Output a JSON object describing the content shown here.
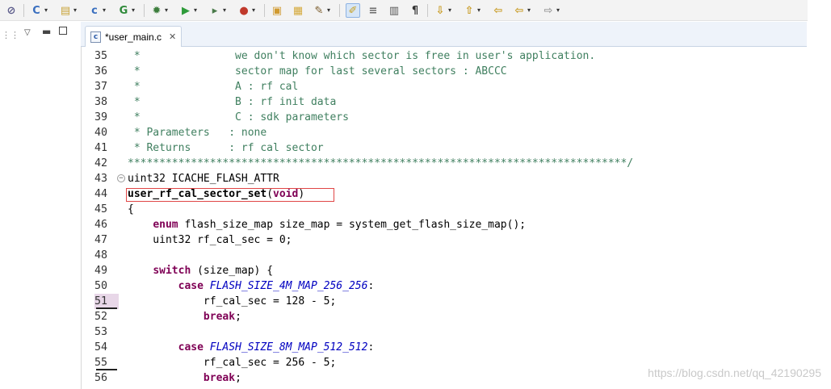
{
  "toolbar": {
    "items": [
      {
        "name": "skip-breakpoints-icon",
        "glyph": "⊘",
        "color": "#5a5a8a",
        "drop": false
      },
      {
        "name": "new-c-project-icon",
        "glyph": "C",
        "color": "#3a6fbf",
        "drop": true
      },
      {
        "name": "new-folder-icon",
        "glyph": "▤",
        "color": "#c8a33a",
        "drop": true
      },
      {
        "name": "new-c-file-icon",
        "glyph": "c",
        "color": "#3a6fbf",
        "drop": true
      },
      {
        "name": "new-class-icon",
        "glyph": "G",
        "color": "#2f8a3a",
        "drop": true
      },
      {
        "name": "debug-icon",
        "glyph": "✹",
        "color": "#3c7d3c",
        "drop": true
      },
      {
        "name": "run-icon",
        "glyph": "▶",
        "color": "#2e9b3a",
        "drop": true
      },
      {
        "name": "run-last-icon",
        "glyph": "▸",
        "color": "#4a7a4a",
        "drop": true
      },
      {
        "name": "external-tools-icon",
        "glyph": "●",
        "color": "#c0392b",
        "drop": true
      },
      {
        "name": "open-type-icon",
        "glyph": "▣",
        "color": "#d09a30",
        "drop": false
      },
      {
        "name": "open-folder-icon",
        "glyph": "▦",
        "color": "#d5a93a",
        "drop": false
      },
      {
        "name": "search-icon",
        "glyph": "✎",
        "color": "#7a5b2a",
        "drop": true
      },
      {
        "name": "mark-occurrences-icon",
        "glyph": "✐",
        "color": "#c7a020",
        "drop": false,
        "active": true
      },
      {
        "name": "toggle-comment-icon",
        "glyph": "≡",
        "color": "#6a6a6a",
        "drop": false
      },
      {
        "name": "show-whitespace-icon",
        "glyph": "▥",
        "color": "#555555",
        "drop": false
      },
      {
        "name": "paragraph-icon",
        "glyph": "¶",
        "color": "#333333",
        "drop": false
      },
      {
        "name": "next-annotation-icon",
        "glyph": "⇩",
        "color": "#c89a20",
        "drop": true
      },
      {
        "name": "previous-annotation-icon",
        "glyph": "⇧",
        "color": "#c89a20",
        "drop": true
      },
      {
        "name": "back-to-edit-icon",
        "glyph": "⇦",
        "color": "#c89a20",
        "drop": false
      },
      {
        "name": "back-icon",
        "glyph": "⇦",
        "color": "#c89a20",
        "drop": true
      },
      {
        "name": "forward-icon",
        "glyph": "⇨",
        "color": "#9a9a9a",
        "drop": true
      }
    ]
  },
  "left_panel": {
    "icons": [
      "view-menu-icon",
      "minimize-icon",
      "maximize-icon"
    ]
  },
  "tab": {
    "title": "*user_main.c",
    "close_glyph": "✕",
    "icon_glyph": "c"
  },
  "code": [
    {
      "n": "35",
      "segs": [
        {
          "t": " *               we don't know which sector is free in user's application.",
          "c": "c"
        }
      ]
    },
    {
      "n": "36",
      "segs": [
        {
          "t": " *               sector map for last several sectors : ABCCC",
          "c": "c"
        }
      ]
    },
    {
      "n": "37",
      "segs": [
        {
          "t": " *               A : rf cal",
          "c": "c"
        }
      ]
    },
    {
      "n": "38",
      "segs": [
        {
          "t": " *               B : rf init data",
          "c": "c"
        }
      ]
    },
    {
      "n": "39",
      "segs": [
        {
          "t": " *               C : sdk parameters",
          "c": "c"
        }
      ]
    },
    {
      "n": "40",
      "segs": [
        {
          "t": " * Parameters   : none",
          "c": "c"
        }
      ]
    },
    {
      "n": "41",
      "segs": [
        {
          "t": " * Returns      : rf cal sector",
          "c": "c"
        }
      ]
    },
    {
      "n": "42",
      "segs": [
        {
          "t": "*******************************************************************************/",
          "c": "c"
        }
      ]
    },
    {
      "n": "43",
      "fold": true,
      "segs": [
        {
          "t": "uint32 ICACHE_FLASH_ATTR",
          "c": "plain"
        }
      ]
    },
    {
      "n": "44",
      "segs": [
        {
          "t": "user_rf_cal_sector_set",
          "c": "b"
        },
        {
          "t": "(",
          "c": "plain"
        },
        {
          "t": "void",
          "c": "kw"
        },
        {
          "t": ")",
          "c": "plain"
        }
      ]
    },
    {
      "n": "45",
      "segs": [
        {
          "t": "{",
          "c": "plain"
        }
      ]
    },
    {
      "n": "46",
      "segs": [
        {
          "t": "    ",
          "c": "plain"
        },
        {
          "t": "enum",
          "c": "kw"
        },
        {
          "t": " flash_size_map size_map = system_get_flash_size_map();",
          "c": "plain"
        }
      ]
    },
    {
      "n": "47",
      "segs": [
        {
          "t": "    uint32 rf_cal_sec = 0;",
          "c": "plain"
        }
      ]
    },
    {
      "n": "48",
      "segs": [
        {
          "t": "",
          "c": "plain"
        }
      ]
    },
    {
      "n": "49",
      "segs": [
        {
          "t": "    ",
          "c": "plain"
        },
        {
          "t": "switch",
          "c": "kw"
        },
        {
          "t": " (size_map) {",
          "c": "plain"
        }
      ]
    },
    {
      "n": "50",
      "segs": [
        {
          "t": "        ",
          "c": "plain"
        },
        {
          "t": "case",
          "c": "kw"
        },
        {
          "t": " ",
          "c": "plain"
        },
        {
          "t": "FLASH_SIZE_4M_MAP_256_256",
          "c": "en"
        },
        {
          "t": ":",
          "c": "plain"
        }
      ]
    },
    {
      "n": "51",
      "hl": true,
      "bar": true,
      "segs": [
        {
          "t": "            rf_cal_sec = 128 - 5;",
          "c": "plain"
        }
      ]
    },
    {
      "n": "52",
      "segs": [
        {
          "t": "            ",
          "c": "plain"
        },
        {
          "t": "break",
          "c": "kw"
        },
        {
          "t": ";",
          "c": "plain"
        }
      ]
    },
    {
      "n": "53",
      "segs": [
        {
          "t": "",
          "c": "plain"
        }
      ]
    },
    {
      "n": "54",
      "segs": [
        {
          "t": "        ",
          "c": "plain"
        },
        {
          "t": "case",
          "c": "kw"
        },
        {
          "t": " ",
          "c": "plain"
        },
        {
          "t": "FLASH_SIZE_8M_MAP_512_512",
          "c": "en"
        },
        {
          "t": ":",
          "c": "plain"
        }
      ]
    },
    {
      "n": "55",
      "bar": true,
      "segs": [
        {
          "t": "            rf_cal_sec = 256 - 5;",
          "c": "plain"
        }
      ]
    },
    {
      "n": "56",
      "segs": [
        {
          "t": "            ",
          "c": "plain"
        },
        {
          "t": "break",
          "c": "kw"
        },
        {
          "t": ";",
          "c": "plain"
        }
      ]
    }
  ],
  "watermark": "https://blog.csdn.net/qq_42190295"
}
